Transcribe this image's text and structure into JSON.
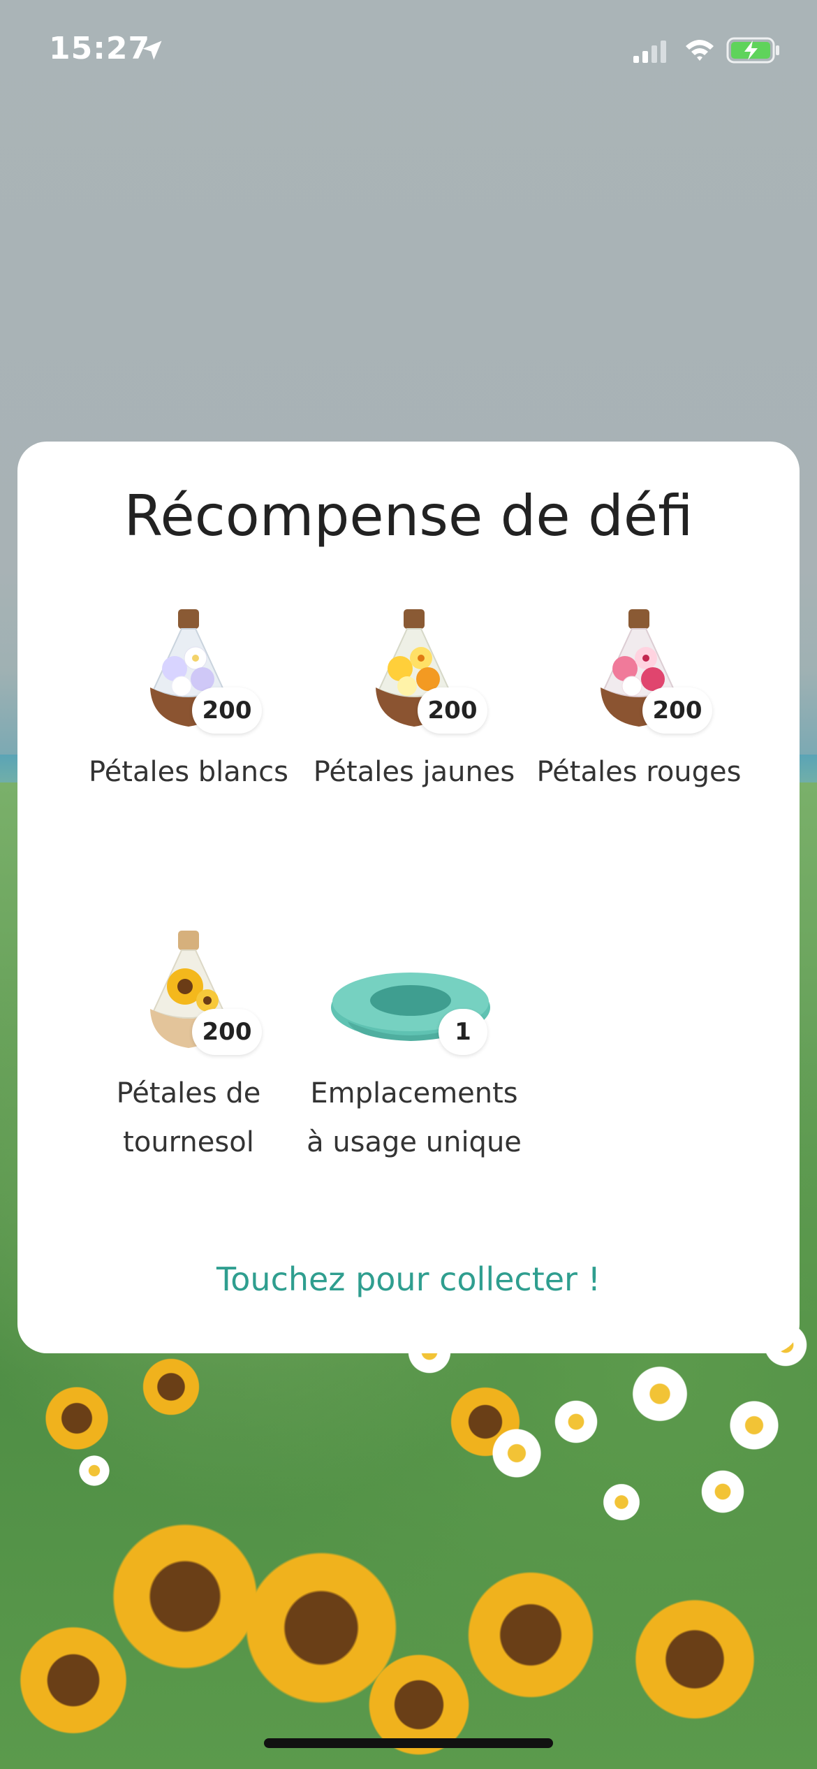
{
  "status_bar": {
    "time": "15:27",
    "icons": [
      "location-arrow-icon",
      "cellular-signal-icon",
      "wifi-icon",
      "battery-charging-icon"
    ],
    "battery_color": "#5fd35b"
  },
  "modal": {
    "title": "Récompense de défi",
    "rewards": [
      {
        "label": "Pétales blancs",
        "quantity": "200",
        "icon": "white-petals-vase-icon"
      },
      {
        "label": "Pétales jaunes",
        "quantity": "200",
        "icon": "yellow-petals-vase-icon"
      },
      {
        "label": "Pétales rouges",
        "quantity": "200",
        "icon": "red-petals-vase-icon"
      },
      {
        "label_line1": "Pétales de",
        "label_line2": "tournesol",
        "quantity": "200",
        "icon": "sunflower-petals-vase-icon"
      },
      {
        "label_line1": "Emplacements",
        "label_line2": "à usage unique",
        "quantity": "1",
        "icon": "single-use-slot-icon"
      }
    ],
    "collect_label": "Touchez pour collecter !",
    "accent_color": "#2f9e8f"
  }
}
